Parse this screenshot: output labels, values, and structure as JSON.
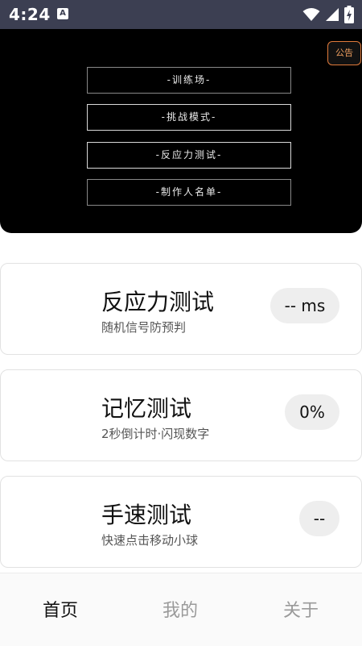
{
  "status_bar": {
    "time": "4:24",
    "notification_icon": "A",
    "icons": [
      "wifi-icon",
      "signal-icon",
      "battery-charging-icon"
    ]
  },
  "hero": {
    "notice_label": "公告",
    "menu": [
      {
        "label": "-训练场-"
      },
      {
        "label": "-挑战模式-"
      },
      {
        "label": "-反应力测试-"
      },
      {
        "label": "-制作人名单-"
      }
    ]
  },
  "cards": [
    {
      "title": "反应力测试",
      "subtitle": "随机信号防预判",
      "value": "-- ms"
    },
    {
      "title": "记忆测试",
      "subtitle": "2秒倒计时·闪现数字",
      "value": "0%"
    },
    {
      "title": "手速测试",
      "subtitle": "快速点击移动小球",
      "value": "--"
    }
  ],
  "bottom_nav": {
    "items": [
      {
        "label": "首页",
        "active": true
      },
      {
        "label": "我的",
        "active": false
      },
      {
        "label": "关于",
        "active": false
      }
    ]
  },
  "colors": {
    "status_bar_bg": "#3c3f52",
    "hero_bg": "#000000",
    "notice_accent": "#e07a3b",
    "pill_bg": "#eeeeee"
  }
}
